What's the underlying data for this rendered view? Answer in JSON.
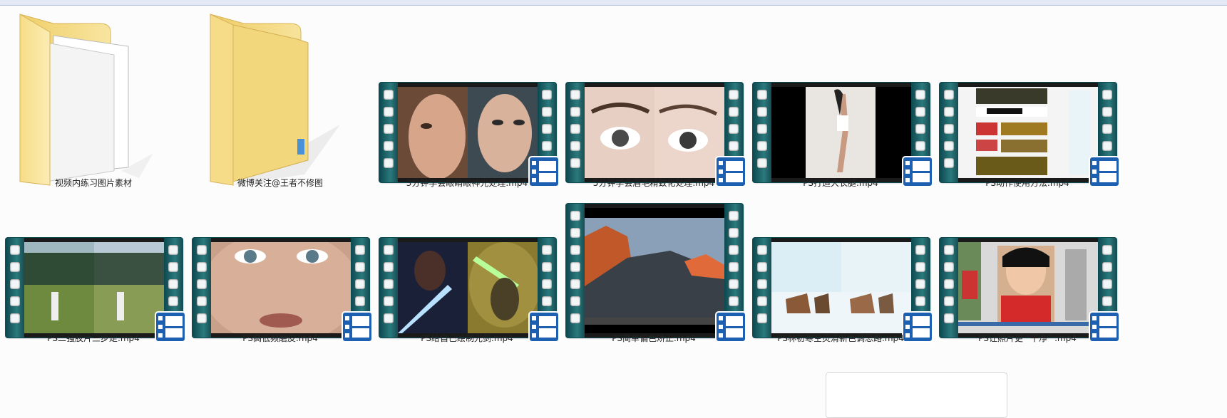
{
  "items": [
    {
      "name": "视频内练习图片素材",
      "type": "folder-with-files"
    },
    {
      "name": "微博关注@王者不修图",
      "type": "folder"
    },
    {
      "name": "3分钟学会眼睛眼神光处理.mp4",
      "type": "video"
    },
    {
      "name": "5分钟学会眉毛精致化处理.mp4",
      "type": "video"
    },
    {
      "name": "PS打造大长腿.mp4",
      "type": "video"
    },
    {
      "name": "PS动作使用方法.mp4",
      "type": "video"
    },
    {
      "name": "PS二强胶片三步走.mp4",
      "type": "video"
    },
    {
      "name": "PS高低频磨皮.mp4",
      "type": "video"
    },
    {
      "name": "PS给自己绘制光剑.mp4",
      "type": "video"
    },
    {
      "name": "PS简单偏色矫正.mp4",
      "type": "video"
    },
    {
      "name": "PS林初寒空灵清新色调思路.mp4",
      "type": "video"
    },
    {
      "name": "PS让照片更 “干净” .mp4",
      "type": "video"
    }
  ],
  "colors": {
    "background": "#fcfcfc",
    "folder": "#f3d77c",
    "filmstrip": "#1e6a6e",
    "badge": "#1d5fb0"
  },
  "icons": [
    "folder-icon",
    "video-file-icon",
    "film-strip",
    "video-badge-icon"
  ]
}
